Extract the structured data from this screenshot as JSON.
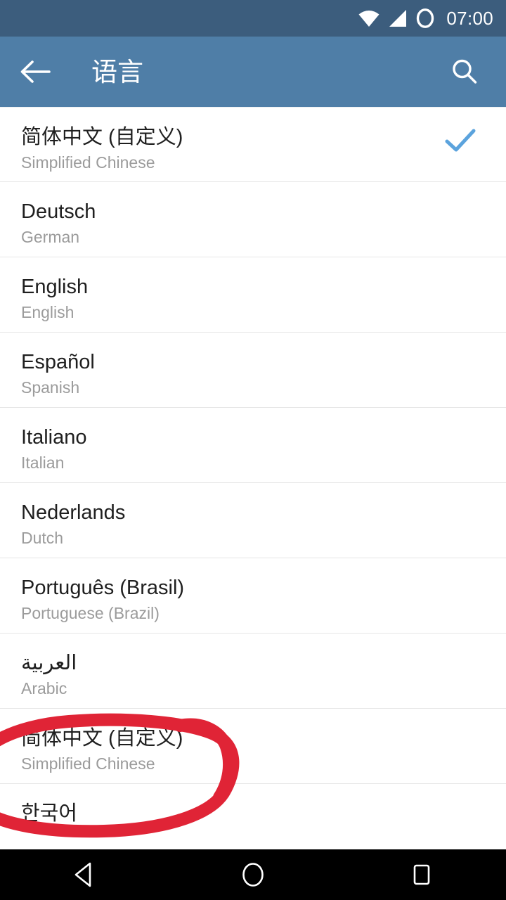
{
  "status_bar": {
    "clock": "07:00",
    "icons": [
      "wifi-icon",
      "cellular-signal-icon",
      "alarm-ring-icon"
    ],
    "background_color": "#3c5d7d"
  },
  "app_bar": {
    "title": "语言",
    "back_icon": "back-arrow-icon",
    "search_icon": "search-icon",
    "background_color": "#4f7ea7",
    "text_color": "#ffffff"
  },
  "list": {
    "check_color": "#5ba3dd",
    "divider_color": "#e6e6e6",
    "native_text_color": "#1f1f1f",
    "english_text_color": "#9b9b9b",
    "items": [
      {
        "native": "简体中文 (自定义)",
        "english": "Simplified Chinese",
        "selected": true,
        "rtl": false
      },
      {
        "native": "Deutsch",
        "english": "German",
        "selected": false,
        "rtl": false
      },
      {
        "native": "English",
        "english": "English",
        "selected": false,
        "rtl": false
      },
      {
        "native": "Español",
        "english": "Spanish",
        "selected": false,
        "rtl": false
      },
      {
        "native": "Italiano",
        "english": "Italian",
        "selected": false,
        "rtl": false
      },
      {
        "native": "Nederlands",
        "english": "Dutch",
        "selected": false,
        "rtl": false
      },
      {
        "native": "Português (Brasil)",
        "english": "Portuguese (Brazil)",
        "selected": false,
        "rtl": false
      },
      {
        "native": "العربية",
        "english": "Arabic",
        "selected": false,
        "rtl": true
      },
      {
        "native": "简体中文 (自定义)",
        "english": "Simplified Chinese",
        "selected": false,
        "rtl": false
      },
      {
        "native": "한국어",
        "english": "",
        "selected": false,
        "rtl": false
      }
    ]
  },
  "annotation": {
    "type": "hand-drawn-ellipse",
    "color": "#e02436",
    "target_item_index": 8,
    "stroke_width": 18
  },
  "nav_bar": {
    "background_color": "#000000",
    "buttons": [
      {
        "name": "nav-back-button",
        "icon": "triangle-back-icon"
      },
      {
        "name": "nav-home-button",
        "icon": "circle-home-icon"
      },
      {
        "name": "nav-recents-button",
        "icon": "square-recents-icon"
      }
    ]
  }
}
